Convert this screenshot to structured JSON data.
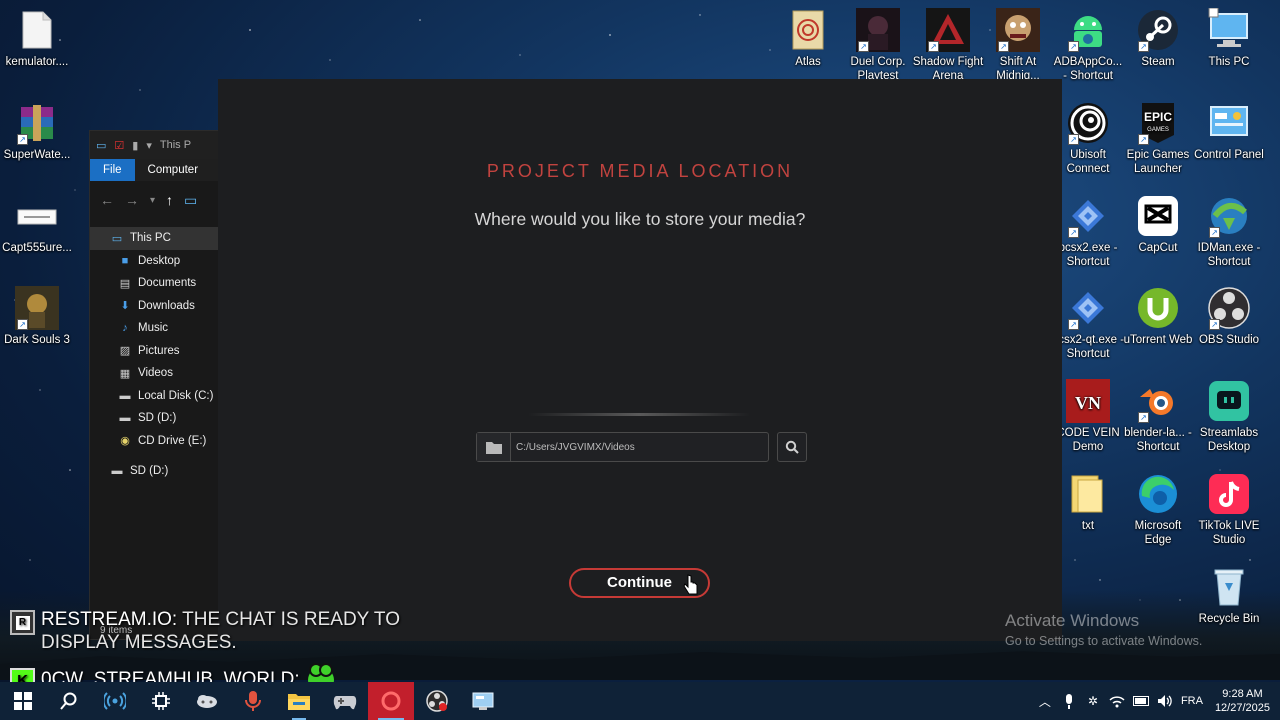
{
  "desktop": {
    "left_icons": [
      {
        "label": "kemulator...."
      },
      {
        "label": "SuperWate..."
      },
      {
        "label": "Capt555ure..."
      },
      {
        "label": "Dark Souls 3"
      }
    ],
    "right_icons": [
      {
        "label": "Atlas"
      },
      {
        "label": "Duel Corp. Playtest"
      },
      {
        "label": "Shadow Fight Arena"
      },
      {
        "label": "Shift At Midnig..."
      },
      {
        "label": "ADBAppCo... - Shortcut"
      },
      {
        "label": "Steam"
      },
      {
        "label": "This PC"
      },
      {
        "label": "Ubisoft Connect"
      },
      {
        "label": "Epic Games Launcher"
      },
      {
        "label": "Control Panel"
      },
      {
        "label": "pcsx2.exe - Shortcut"
      },
      {
        "label": "CapCut"
      },
      {
        "label": "IDMan.exe - Shortcut"
      },
      {
        "label": "pcsx2-qt.exe - Shortcut"
      },
      {
        "label": "uTorrent Web"
      },
      {
        "label": "OBS Studio"
      },
      {
        "label": "CODE VEIN Demo"
      },
      {
        "label": "blender-la... - Shortcut"
      },
      {
        "label": "Streamlabs Desktop"
      },
      {
        "label": "txt"
      },
      {
        "label": "Microsoft Edge"
      },
      {
        "label": "TikTok LIVE Studio"
      },
      {
        "label": "Recycle Bin"
      }
    ]
  },
  "explorer": {
    "title": "This P",
    "tabs": [
      "File",
      "Computer"
    ],
    "tree": [
      {
        "label": "This PC"
      },
      {
        "label": "Desktop"
      },
      {
        "label": "Documents"
      },
      {
        "label": "Downloads"
      },
      {
        "label": "Music"
      },
      {
        "label": "Pictures"
      },
      {
        "label": "Videos"
      },
      {
        "label": "Local Disk (C:)"
      },
      {
        "label": "SD (D:)"
      },
      {
        "label": "CD Drive (E:)"
      },
      {
        "label": "SD (D:)"
      }
    ],
    "status": "9 items"
  },
  "dialog": {
    "heading": "PROJECT MEDIA LOCATION",
    "question": "Where would you like to store your media?",
    "path_value": "C:/Users/JVGVIMX/Videos",
    "continue_label": "Continue"
  },
  "activation": {
    "title": "Activate Windows",
    "subtitle": "Go to Settings to activate Windows."
  },
  "chat": {
    "line1_name": "RESTREAM.IO:",
    "line1_text": " THE CHAT IS READY TO DISPLAY MESSAGES.",
    "line2_name": "0CW_STREAMHUB_WORLD:"
  },
  "taskbar": {
    "language": "FRA",
    "time": "9:28 AM",
    "date": "12/27/2025"
  },
  "colors": {
    "accent_red": "#c63a36",
    "heading_red": "#c1433f",
    "file_tab_blue": "#1b6fc4",
    "taskbar_bg": "#0f2237"
  }
}
